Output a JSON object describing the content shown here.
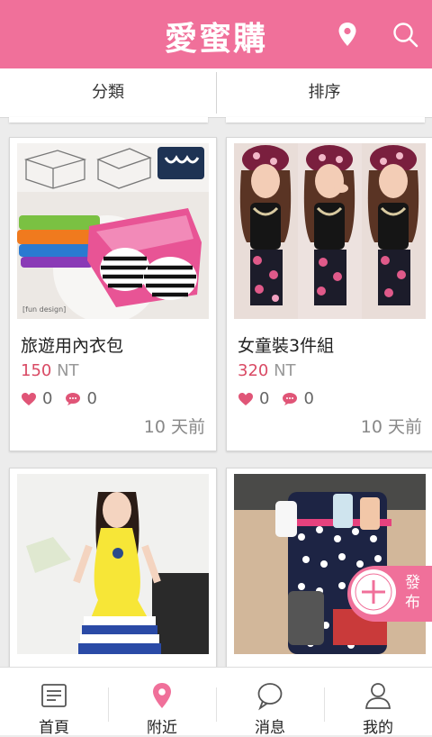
{
  "header": {
    "title": "愛蜜購",
    "location_icon": "location-pin-icon",
    "search_icon": "search-icon"
  },
  "filters": {
    "category": "分類",
    "sort": "排序"
  },
  "products": [
    {
      "title": "旅遊用內衣包",
      "price": "150",
      "currency": "NT",
      "likes": "0",
      "comments": "0",
      "posted": "10 天前",
      "thumb_text": "[fun design]"
    },
    {
      "title": "女童裝3件組",
      "price": "320",
      "currency": "NT",
      "likes": "0",
      "comments": "0",
      "posted": "10 天前"
    }
  ],
  "fab": {
    "label": "發布"
  },
  "nav": [
    {
      "label": "首頁",
      "icon": "home-icon"
    },
    {
      "label": "附近",
      "icon": "location-pin-icon"
    },
    {
      "label": "消息",
      "icon": "message-icon"
    },
    {
      "label": "我的",
      "icon": "profile-icon"
    }
  ],
  "colors": {
    "brand": "#f0709a",
    "price": "#d94a64",
    "active_nav": "#f0709a"
  }
}
